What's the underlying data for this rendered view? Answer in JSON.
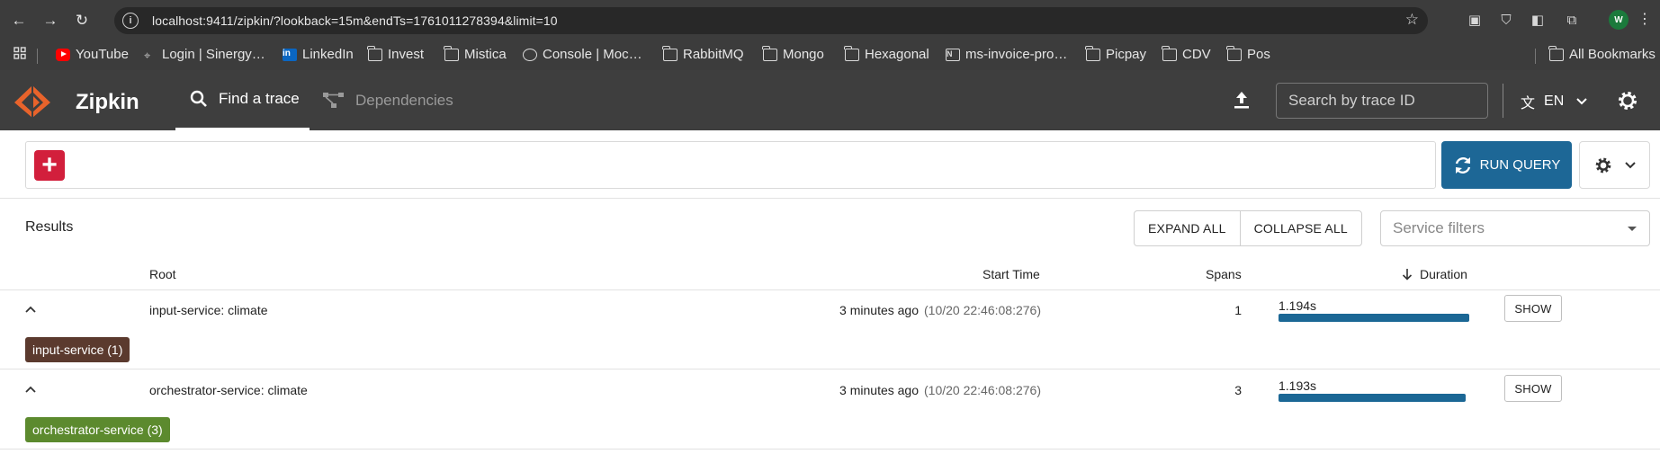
{
  "browser": {
    "url": "localhost:9411/zipkin/?lookback=15m&endTs=1761011278394&limit=10",
    "profile_initial": "W",
    "bookmarks": [
      {
        "label": "YouTube",
        "icon": "youtube-icon"
      },
      {
        "label": "Login | Sinergy…",
        "icon": "globe-icon"
      },
      {
        "label": "LinkedIn",
        "icon": "linkedin-icon"
      },
      {
        "label": "Invest",
        "icon": "folder-icon"
      },
      {
        "label": "Mistica",
        "icon": "folder-icon"
      },
      {
        "label": "Console | Moc…",
        "icon": "circle-icon"
      },
      {
        "label": "RabbitMQ",
        "icon": "folder-icon"
      },
      {
        "label": "Mongo",
        "icon": "folder-icon"
      },
      {
        "label": "Hexagonal",
        "icon": "folder-icon"
      },
      {
        "label": "ms-invoice-pro…",
        "icon": "notion-icon"
      },
      {
        "label": "Picpay",
        "icon": "folder-icon"
      },
      {
        "label": "CDV",
        "icon": "folder-icon"
      },
      {
        "label": "Pos",
        "icon": "folder-icon"
      }
    ],
    "all_bookmarks": "All Bookmarks"
  },
  "header": {
    "app_name": "Zipkin",
    "tabs": [
      "Find a trace",
      "Dependencies"
    ],
    "search_placeholder": "Search by trace ID",
    "language": "EN"
  },
  "query": {
    "run_label": "RUN QUERY"
  },
  "results": {
    "label": "Results",
    "expand_all": "EXPAND ALL",
    "collapse_all": "COLLAPSE ALL",
    "service_filter_placeholder": "Service filters",
    "columns": {
      "root": "Root",
      "start_time": "Start Time",
      "spans": "Spans",
      "duration": "Duration"
    },
    "show_label": "SHOW",
    "rows": [
      {
        "root": "input-service: climate",
        "start_relative": "3 minutes ago",
        "start_absolute": "(10/20 22:46:08:276)",
        "spans": "1",
        "duration": "1.194s",
        "duration_fraction": 1.0,
        "service_badge": "input-service (1)",
        "badge_color": "#5b3a2e"
      },
      {
        "root": "orchestrator-service: climate",
        "start_relative": "3 minutes ago",
        "start_absolute": "(10/20 22:46:08:276)",
        "spans": "3",
        "duration": "1.193s",
        "duration_fraction": 0.983,
        "service_badge": "orchestrator-service (3)",
        "badge_color": "#5c8a2e"
      }
    ]
  },
  "colors": {
    "header_bg": "#3e3e3e",
    "accent_blue": "#1d6796",
    "add_red": "#d21f3c",
    "logo_orange": "#e8632b"
  }
}
